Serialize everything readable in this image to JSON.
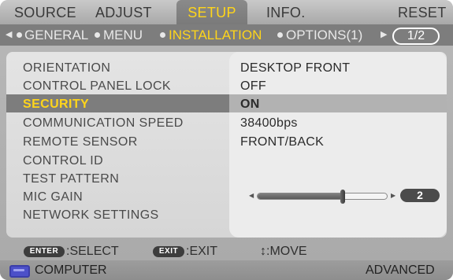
{
  "tabs": [
    {
      "label": "SOURCE",
      "active": false
    },
    {
      "label": "ADJUST",
      "active": false
    },
    {
      "label": "SETUP",
      "active": true
    },
    {
      "label": "INFO.",
      "active": false
    },
    {
      "label": "RESET",
      "active": false
    }
  ],
  "subtabs": [
    {
      "label": "GENERAL",
      "active": false
    },
    {
      "label": "MENU",
      "active": false
    },
    {
      "label": "INSTALLATION",
      "active": true
    },
    {
      "label": "OPTIONS(1)",
      "active": false
    }
  ],
  "page_indicator": "1/2",
  "menu": [
    {
      "label": "ORIENTATION",
      "value": "DESKTOP FRONT"
    },
    {
      "label": "CONTROL PANEL LOCK",
      "value": "OFF"
    },
    {
      "label": "SECURITY",
      "value": "ON",
      "selected": true
    },
    {
      "label": "COMMUNICATION SPEED",
      "value": "38400bps"
    },
    {
      "label": "REMOTE SENSOR",
      "value": "FRONT/BACK"
    },
    {
      "label": "CONTROL ID",
      "value": ""
    },
    {
      "label": "TEST PATTERN",
      "value": ""
    },
    {
      "label": "MIC GAIN",
      "value": ""
    },
    {
      "label": "NETWORK SETTINGS",
      "value": ""
    }
  ],
  "mic_gain": {
    "value": "2",
    "level_fraction": 0.66
  },
  "footer": {
    "enter_key": "ENTER",
    "enter_action": ":SELECT",
    "exit_key": "EXIT",
    "exit_action": ":EXIT",
    "move_action": "↕:MOVE"
  },
  "status": {
    "source": "COMPUTER",
    "mode": "ADVANCED"
  },
  "colors": {
    "active_highlight": "#ffd51a",
    "selection_bar": "#7d7d7d",
    "source_icon": "#4c50c9"
  }
}
